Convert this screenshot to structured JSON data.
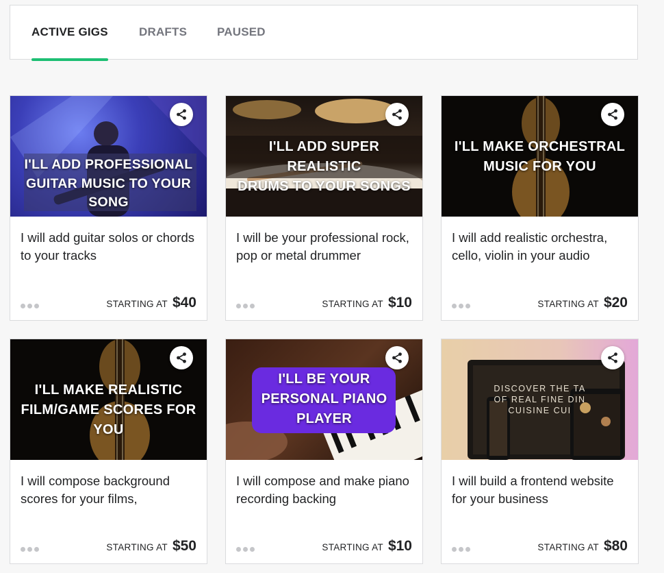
{
  "tabs": [
    {
      "label": "ACTIVE GIGS",
      "active": true
    },
    {
      "label": "DRAFTS",
      "active": false
    },
    {
      "label": "PAUSED",
      "active": false
    }
  ],
  "accent_color": "#1dbf73",
  "gigs": [
    {
      "thumbnail_text": "I'LL ADD PROFESSIONAL\nGUITAR MUSIC TO YOUR\nSONG",
      "title": "I will add guitar solos or chords to your tracks",
      "price_label": "STARTING AT",
      "price": "$40"
    },
    {
      "thumbnail_text": "I'LL ADD SUPER REALISTIC\nDRUMS TO YOUR SONGS",
      "title": "I will be your professional rock, pop or metal drummer",
      "price_label": "STARTING AT",
      "price": "$10"
    },
    {
      "thumbnail_text": "I'LL MAKE ORCHESTRAL\nMUSIC FOR YOU",
      "title": "I will add realistic orchestra, cello, violin in your audio",
      "price_label": "STARTING AT",
      "price": "$20"
    },
    {
      "thumbnail_text": "I'LL MAKE REALISTIC\nFILM/GAME SCORES FOR\nYOU",
      "title": "I will compose background scores for your films,",
      "price_label": "STARTING AT",
      "price": "$50"
    },
    {
      "thumbnail_text": "I'LL BE YOUR\nPERSONAL PIANO\nPLAYER",
      "title": "I will compose and make piano recording backing",
      "price_label": "STARTING AT",
      "price": "$10"
    },
    {
      "thumbnail_text": "DISCOVER THE TA\nOF REAL FINE DIN\nCUISINE CUI",
      "title": "I will build a frontend website for your business",
      "price_label": "STARTING AT",
      "price": "$80"
    }
  ]
}
